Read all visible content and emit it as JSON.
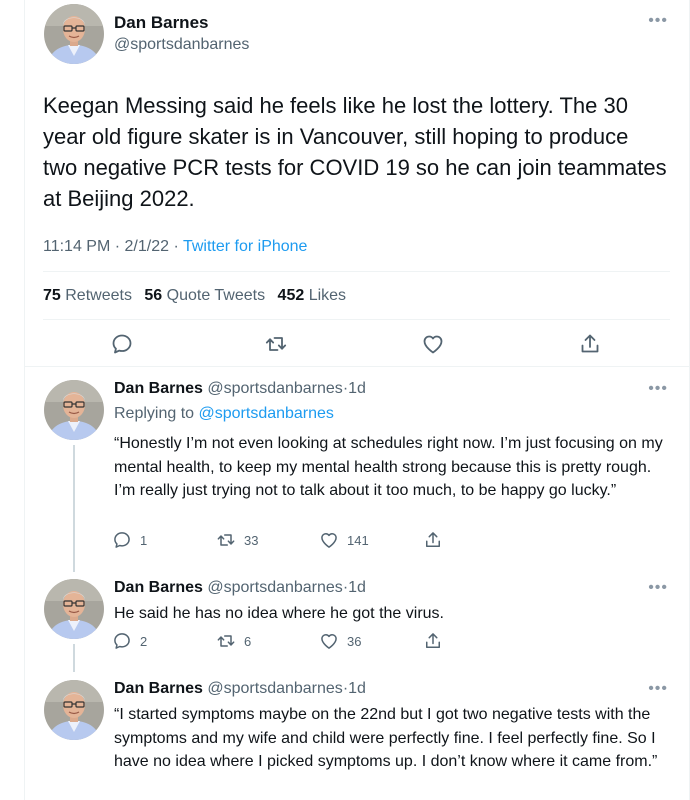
{
  "main_tweet": {
    "author_name": "Dan Barnes",
    "author_handle": "@sportsdanbarnes",
    "more_icon": "more-icon",
    "text": "Keegan Messing said he feels like he lost the lottery. The 30 year old figure skater is in Vancouver, still hoping to produce two negative PCR tests for COVID 19 so he can join teammates at Beijing 2022.",
    "time": "11:14 PM",
    "date": "2/1/22",
    "separator": "·",
    "source": "Twitter for iPhone",
    "stats": {
      "retweets_count": "75",
      "retweets_label": "Retweets",
      "quotes_count": "56",
      "quotes_label": "Quote Tweets",
      "likes_count": "452",
      "likes_label": "Likes"
    },
    "actions": [
      "reply-icon",
      "retweet-icon",
      "like-icon",
      "share-icon"
    ]
  },
  "replies": [
    {
      "author_name": "Dan Barnes",
      "author_handle": "@sportsdanbarnes",
      "time_ago": "1d",
      "replying_prefix": "Replying to",
      "replying_to": "@sportsdanbarnes",
      "text": "“Honestly I’m not even looking at schedules right now. I’m just focusing on my mental health, to keep my mental health strong because this is pretty rough. I’m really just trying not to talk about it too much, to be happy go lucky.”",
      "replies": "1",
      "retweets": "33",
      "likes": "141"
    },
    {
      "author_name": "Dan Barnes",
      "author_handle": "@sportsdanbarnes",
      "time_ago": "1d",
      "text": "He said he has no idea where he got the virus.",
      "replies": "2",
      "retweets": "6",
      "likes": "36"
    },
    {
      "author_name": "Dan Barnes",
      "author_handle": "@sportsdanbarnes",
      "time_ago": "1d",
      "text": "“I started symptoms maybe on the 22nd but I got two negative tests with the symptoms and my wife and child were perfectly fine. I feel perfectly fine. So I have no idea where I picked symptoms up. I don’t know where it came from.”"
    }
  ],
  "colors": {
    "text": "#0f1419",
    "secondary": "#536471",
    "link": "#1d9bf0",
    "divider": "#eff3f4"
  }
}
